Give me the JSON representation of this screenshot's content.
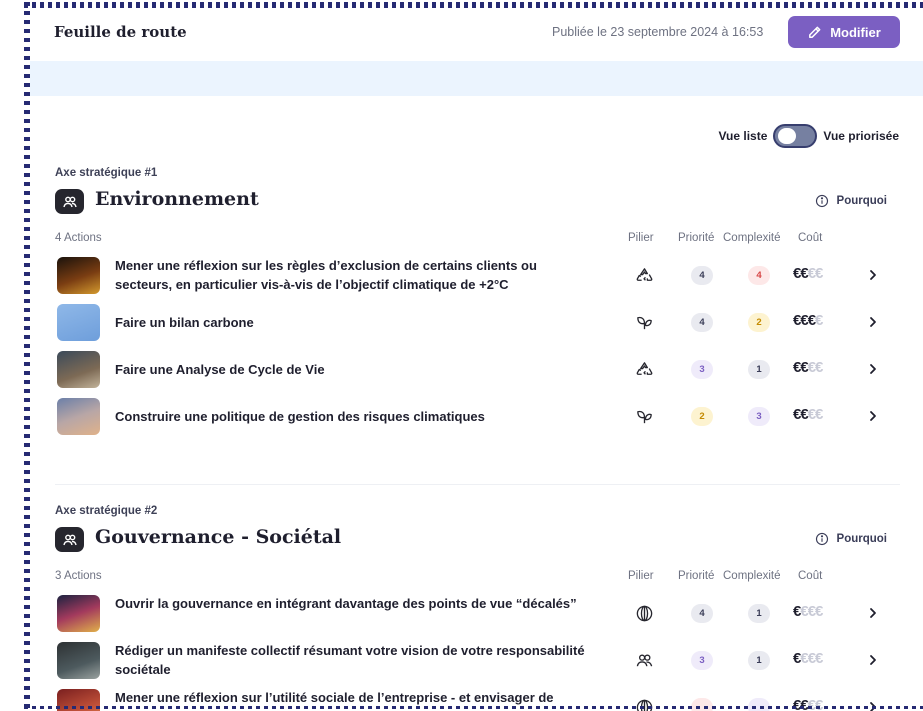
{
  "header": {
    "title": "Feuille de route",
    "published": "Publiée le 23 septembre 2024 à 16:53",
    "edit_label": "Modifier"
  },
  "view_toggle": {
    "left_label": "Vue liste",
    "right_label": "Vue priorisée"
  },
  "columns": {
    "pillar": "Pilier",
    "priority": "Priorité",
    "complexity": "Complexité",
    "cost": "Coût"
  },
  "colors": {
    "accent": "#7b5fc2",
    "banner": "#ebf4fe",
    "pill_grey": "#e9eaf0",
    "pill_red": "#fde8e8",
    "pill_yellow": "#fdf3d0",
    "pill_purple": "#efebfa"
  },
  "axes": [
    {
      "kicker": "Axe stratégique #1",
      "title": "Environnement",
      "why_label": "Pourquoi",
      "count": "4 Actions",
      "actions": [
        {
          "title": "Mener une réflexion sur les règles d’exclusion de certains clients ou secteurs, en particulier vis-à-vis de l’objectif climatique de +2°C",
          "pillar_icon": "recycle-icon",
          "priority": "4",
          "priority_tone": "grey",
          "complexity": "4",
          "complexity_tone": "red",
          "cost": 2
        },
        {
          "title": "Faire un bilan carbone",
          "pillar_icon": "leaf-icon",
          "priority": "4",
          "priority_tone": "grey",
          "complexity": "2",
          "complexity_tone": "yellow",
          "cost": 3
        },
        {
          "title": "Faire une Analyse de Cycle de Vie",
          "pillar_icon": "recycle-icon",
          "priority": "3",
          "priority_tone": "purple",
          "complexity": "1",
          "complexity_tone": "grey",
          "cost": 2
        },
        {
          "title": "Construire une politique de gestion des risques climatiques",
          "pillar_icon": "leaf-icon",
          "priority": "2",
          "priority_tone": "yellow",
          "complexity": "3",
          "complexity_tone": "purple",
          "cost": 2
        }
      ]
    },
    {
      "kicker": "Axe stratégique #2",
      "title": "Gouvernance - Sociétal",
      "why_label": "Pourquoi",
      "count": "3 Actions",
      "actions": [
        {
          "title": "Ouvrir la gouvernance en intégrant davantage des points de vue “décalés”",
          "pillar_icon": "globe-icon",
          "priority": "4",
          "priority_tone": "grey",
          "complexity": "1",
          "complexity_tone": "grey",
          "cost": 1
        },
        {
          "title": "Rédiger un manifeste collectif résumant votre vision de votre responsabilité sociétale",
          "pillar_icon": "people-icon",
          "priority": "3",
          "priority_tone": "purple",
          "complexity": "1",
          "complexity_tone": "grey",
          "cost": 1
        },
        {
          "title": "Mener une réflexion sur l’utilité sociale de l’entreprise - et envisager de",
          "pillar_icon": "globe-icon",
          "priority": "",
          "priority_tone": "red",
          "complexity": "",
          "complexity_tone": "purple",
          "cost": 2
        }
      ]
    }
  ]
}
